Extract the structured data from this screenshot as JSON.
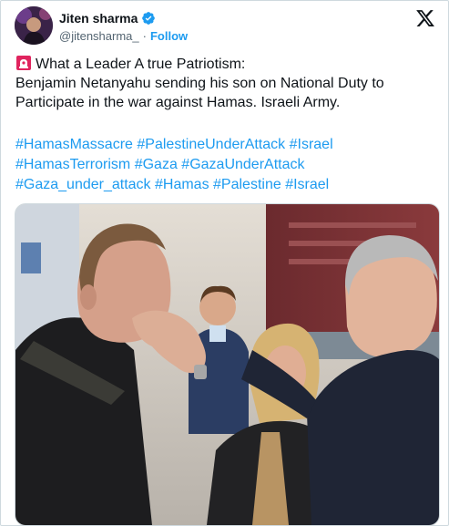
{
  "author": {
    "name": "Jiten sharma",
    "handle": "@jitensharma_",
    "separator": "·",
    "follow_label": "Follow"
  },
  "icons": {
    "avatar": "avatar-image",
    "verified": "verified-badge-icon",
    "logo": "x-logo-icon",
    "siren": "siren-emoji-icon"
  },
  "colors": {
    "link": "#1d9bf0",
    "text": "#0f1419",
    "muted": "#536471",
    "siren": "#e0245e"
  },
  "tweet": {
    "line1": "What a Leader A true Patriotism:",
    "line2": "Benjamin Netanyahu sending his son on National Duty to",
    "line3": "Participate in the war against Hamas. Israeli Army.",
    "hashtag_lines": [
      [
        "#HamasMassacre",
        "#PalestineUnderAttack",
        "#Israel"
      ],
      [
        "#HamasTerrorism",
        "#Gaza",
        "#GazaUnderAttack"
      ],
      [
        "#Gaza_under_attack",
        "#Hamas",
        "#Palestine",
        "#Israel"
      ]
    ]
  }
}
